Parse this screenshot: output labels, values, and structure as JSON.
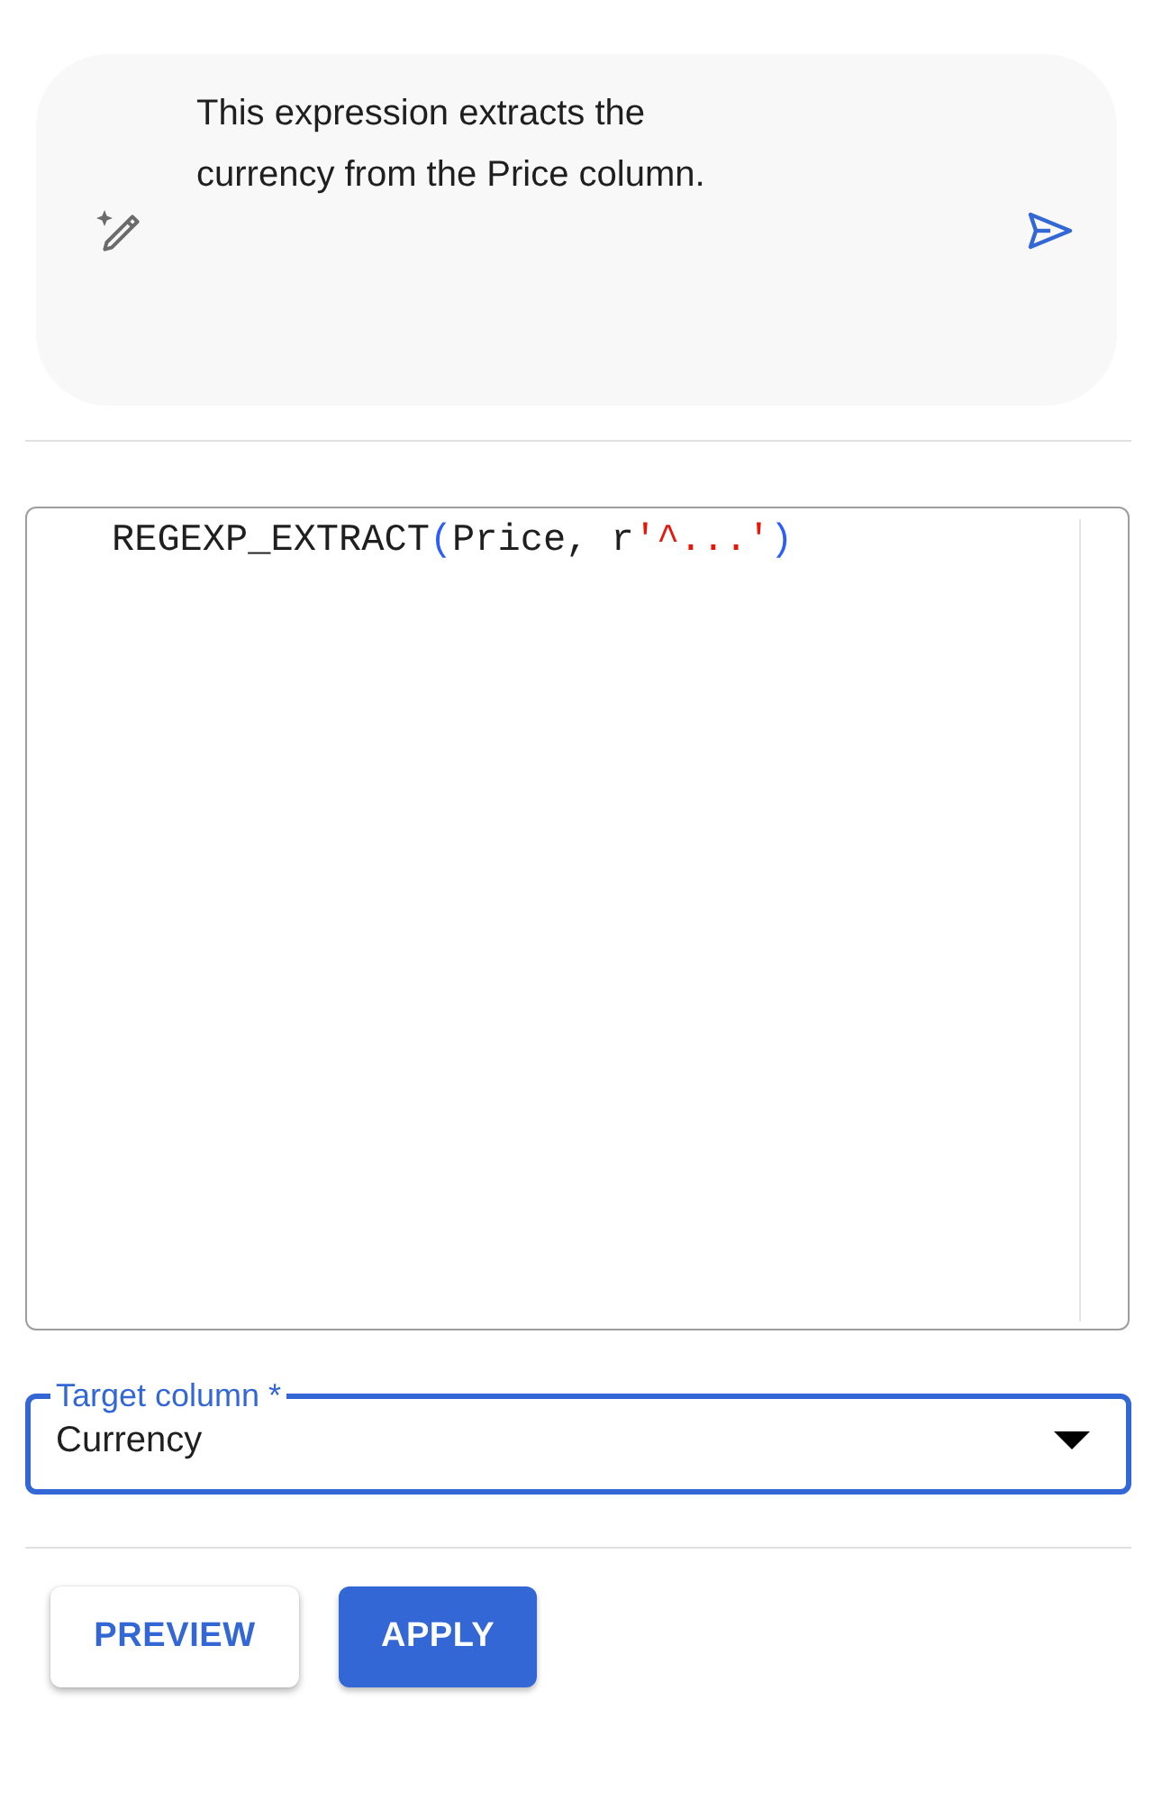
{
  "prompt": {
    "text": "This expression extracts the currency from the Price column."
  },
  "editor": {
    "tokens": [
      {
        "text": "REGEXP_EXTRACT",
        "kind": "plain"
      },
      {
        "text": "(",
        "kind": "bracket"
      },
      {
        "text": "Price, r",
        "kind": "plain"
      },
      {
        "text": "'^...'",
        "kind": "string"
      },
      {
        "text": ")",
        "kind": "bracket"
      }
    ]
  },
  "target_column": {
    "label": "Target column *",
    "value": "Currency",
    "focused": true
  },
  "buttons": [
    {
      "label": "PREVIEW",
      "kind": "secondary"
    },
    {
      "label": "APPLY",
      "kind": "primary"
    }
  ]
}
